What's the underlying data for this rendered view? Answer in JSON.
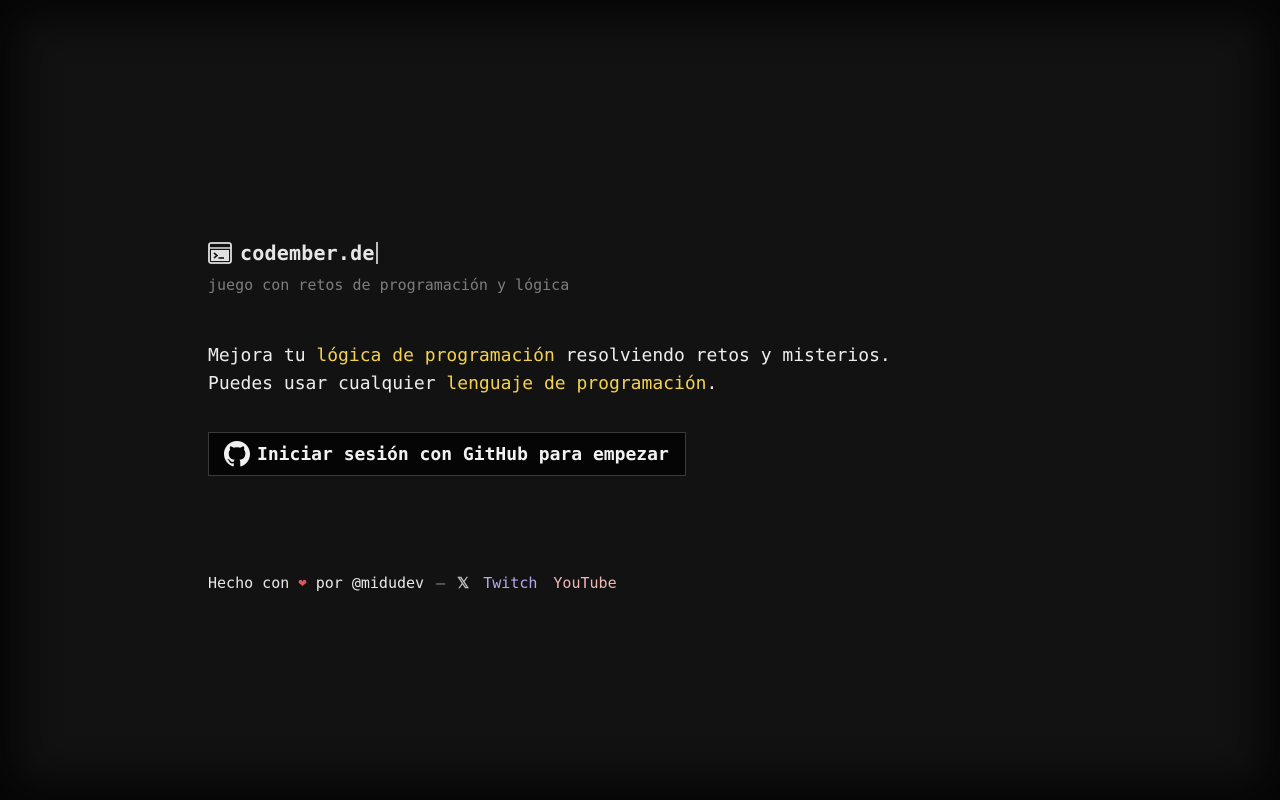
{
  "brand": {
    "icon": "terminal-window-icon",
    "title": "codember.de",
    "tagline": "juego con retos de programación y lógica"
  },
  "intro": {
    "line1_a": "Mejora tu ",
    "line1_highlight": "lógica de programación",
    "line1_b": " resolviendo retos y misterios.",
    "line2_a": "Puedes usar cualquier ",
    "line2_highlight": "lenguaje de programación",
    "line2_b": "."
  },
  "login_button": {
    "icon": "github-icon",
    "label": "Iniciar sesión con GitHub para empezar"
  },
  "footer": {
    "made_with": "Hecho con",
    "heart": "❤",
    "by": "por @midudev",
    "separator": "–",
    "x_label": "𝕏",
    "twitch_label": "Twitch",
    "youtube_label": "YouTube"
  },
  "colors": {
    "background": "#121212",
    "highlight": "#f2d14e",
    "heart": "#e0555e",
    "twitch": "#b7a6ee",
    "youtube": "#f0b5b5"
  }
}
